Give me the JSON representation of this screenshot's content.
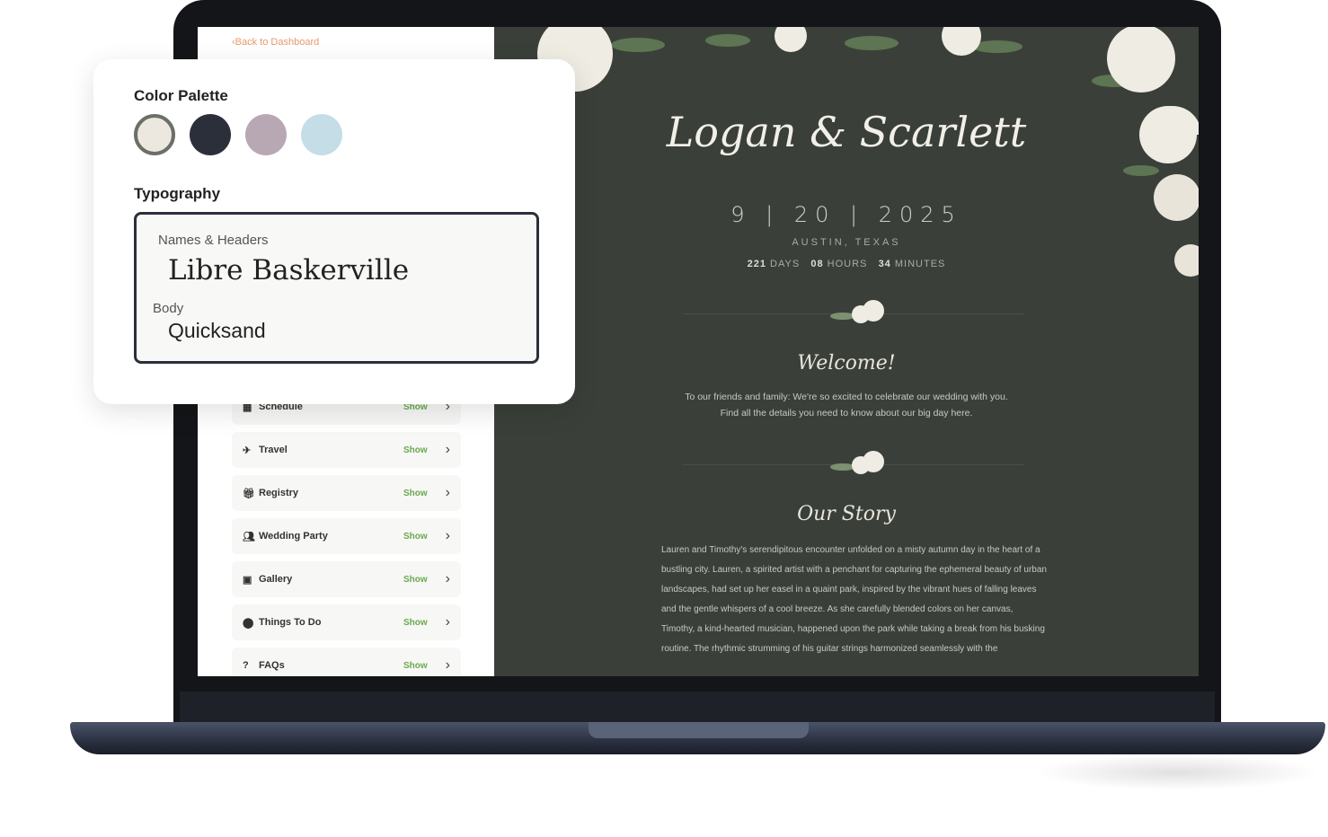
{
  "colors": {
    "accent": "#6aa84f",
    "background": "#3a4039",
    "link": "#e69a6a"
  },
  "sidebar": {
    "back_label": "Back to Dashboard",
    "items": [
      {
        "label": "Schedule",
        "icon": "calendar-icon",
        "status": "Show"
      },
      {
        "label": "Travel",
        "icon": "plane-icon",
        "status": "Show"
      },
      {
        "label": "Registry",
        "icon": "gift-icon",
        "status": "Show"
      },
      {
        "label": "Wedding Party",
        "icon": "users-icon",
        "status": "Show"
      },
      {
        "label": "Gallery",
        "icon": "image-icon",
        "status": "Show"
      },
      {
        "label": "Things To Do",
        "icon": "map-pin-icon",
        "status": "Show"
      },
      {
        "label": "FAQs",
        "icon": "question-icon",
        "status": "Show"
      }
    ]
  },
  "site": {
    "title": "Logan & Scarlett",
    "date": "9 | 20 | 2025",
    "location": "AUSTIN, TEXAS",
    "countdown": {
      "days": "221",
      "days_label": "DAYS",
      "hours": "08",
      "hours_label": "HOURS",
      "minutes": "34",
      "minutes_label": "MINUTES"
    },
    "welcome_title": "Welcome!",
    "welcome_line1": "To our friends and family: We're so excited to celebrate our wedding with you.",
    "welcome_line2": "Find all the details you need to know about our big day here.",
    "story_title": "Our Story",
    "story_text": "Lauren and Timothy's serendipitous encounter unfolded on a misty autumn day in the heart of a bustling city. Lauren, a spirited artist with a penchant for capturing the ephemeral beauty of urban landscapes, had set up her easel in a quaint park, inspired by the vibrant hues of falling leaves and the gentle whispers of a cool breeze. As she carefully blended colors on her canvas, Timothy, a kind-hearted musician, happened upon the park while taking a break from his busking routine. The rhythmic strumming of his guitar strings harmonized seamlessly with the"
  },
  "panel": {
    "palette_title": "Color Palette",
    "palette": [
      "#ece8e0",
      "#2b2f3a",
      "#b8a8b4",
      "#c4dde6"
    ],
    "typography_title": "Typography",
    "headers_label": "Names & Headers",
    "headers_font": "Libre Baskerville",
    "body_label": "Body",
    "body_font": "Quicksand"
  }
}
